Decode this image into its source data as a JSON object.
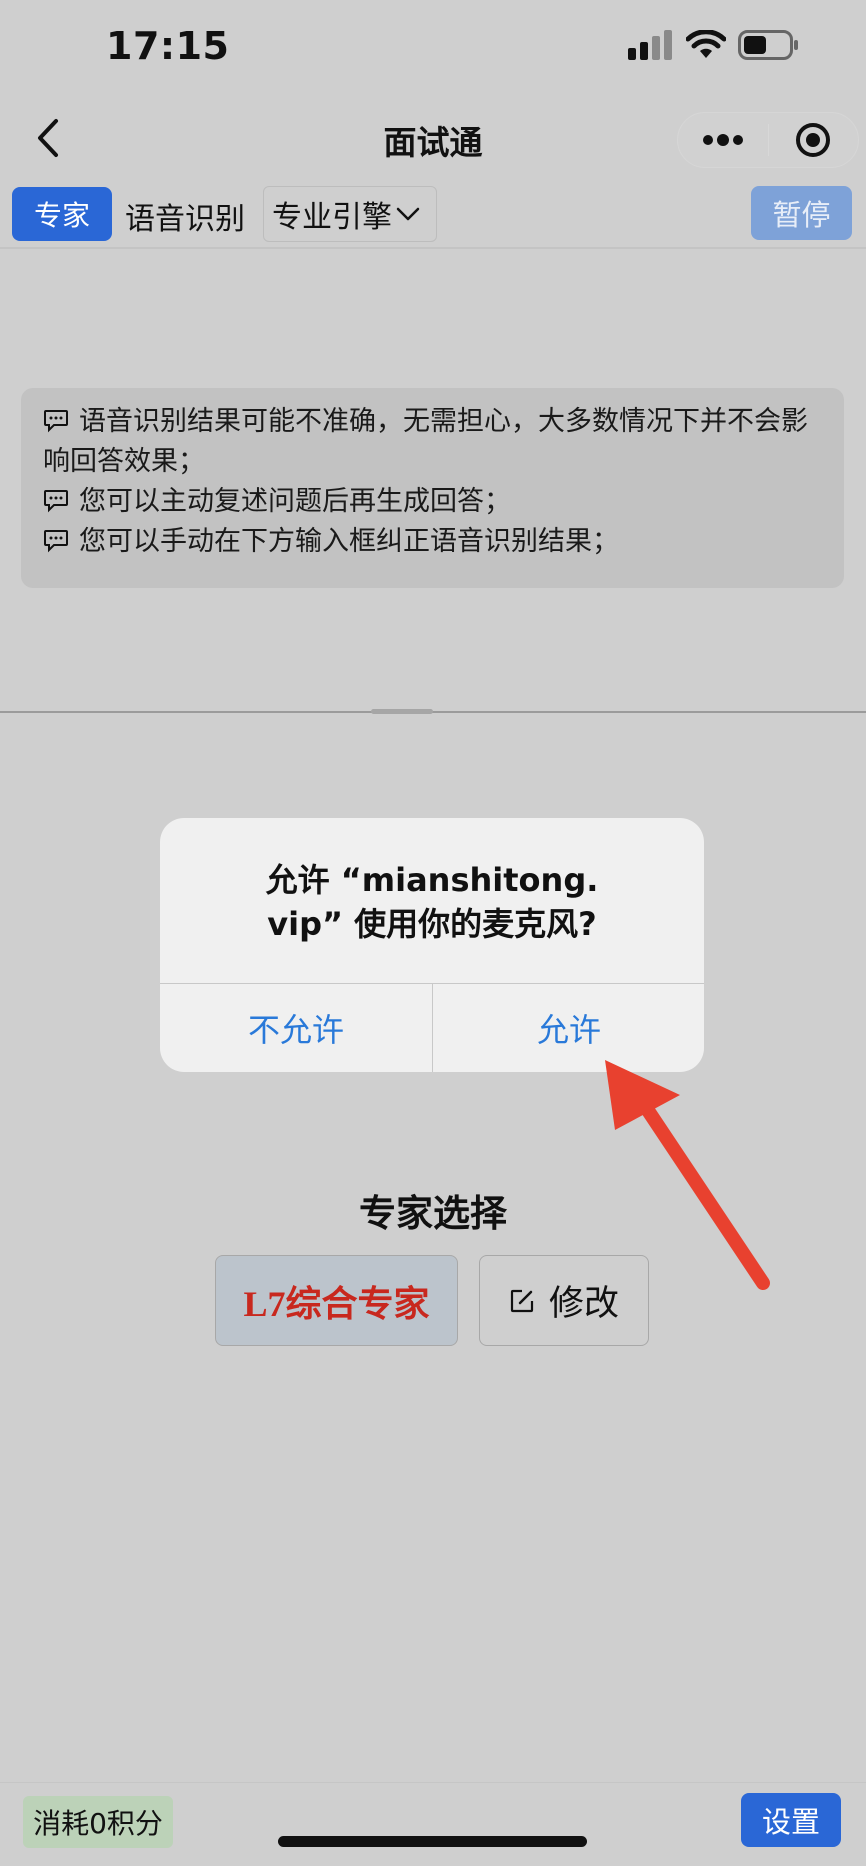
{
  "status_bar": {
    "time": "17:15"
  },
  "nav": {
    "title": "面试通"
  },
  "toolbar": {
    "expert_tag": "专家",
    "asr_label": "语音识别",
    "engine": "专业引擎",
    "pause": "暂停"
  },
  "hints": [
    "语音识别结果可能不准确，无需担心，大多数情况下并不会影响回答效果；",
    "您可以主动复述问题后再生成回答；",
    "您可以手动在下方输入框纠正语音识别结果；"
  ],
  "dialog": {
    "title_line1": "允许 “mianshitong.",
    "title_line2": "vip” 使用你的麦克风?",
    "deny": "不允许",
    "allow": "允许"
  },
  "expert": {
    "section_title": "专家选择",
    "selected": "L7综合专家",
    "edit": "修改"
  },
  "bottom": {
    "points": "消耗0积分",
    "settings": "设置"
  },
  "colors": {
    "accent_blue": "#2a67d6",
    "dialog_link": "#2979d9",
    "expert_red": "#c8281e",
    "arrow_red": "#e8412f"
  }
}
